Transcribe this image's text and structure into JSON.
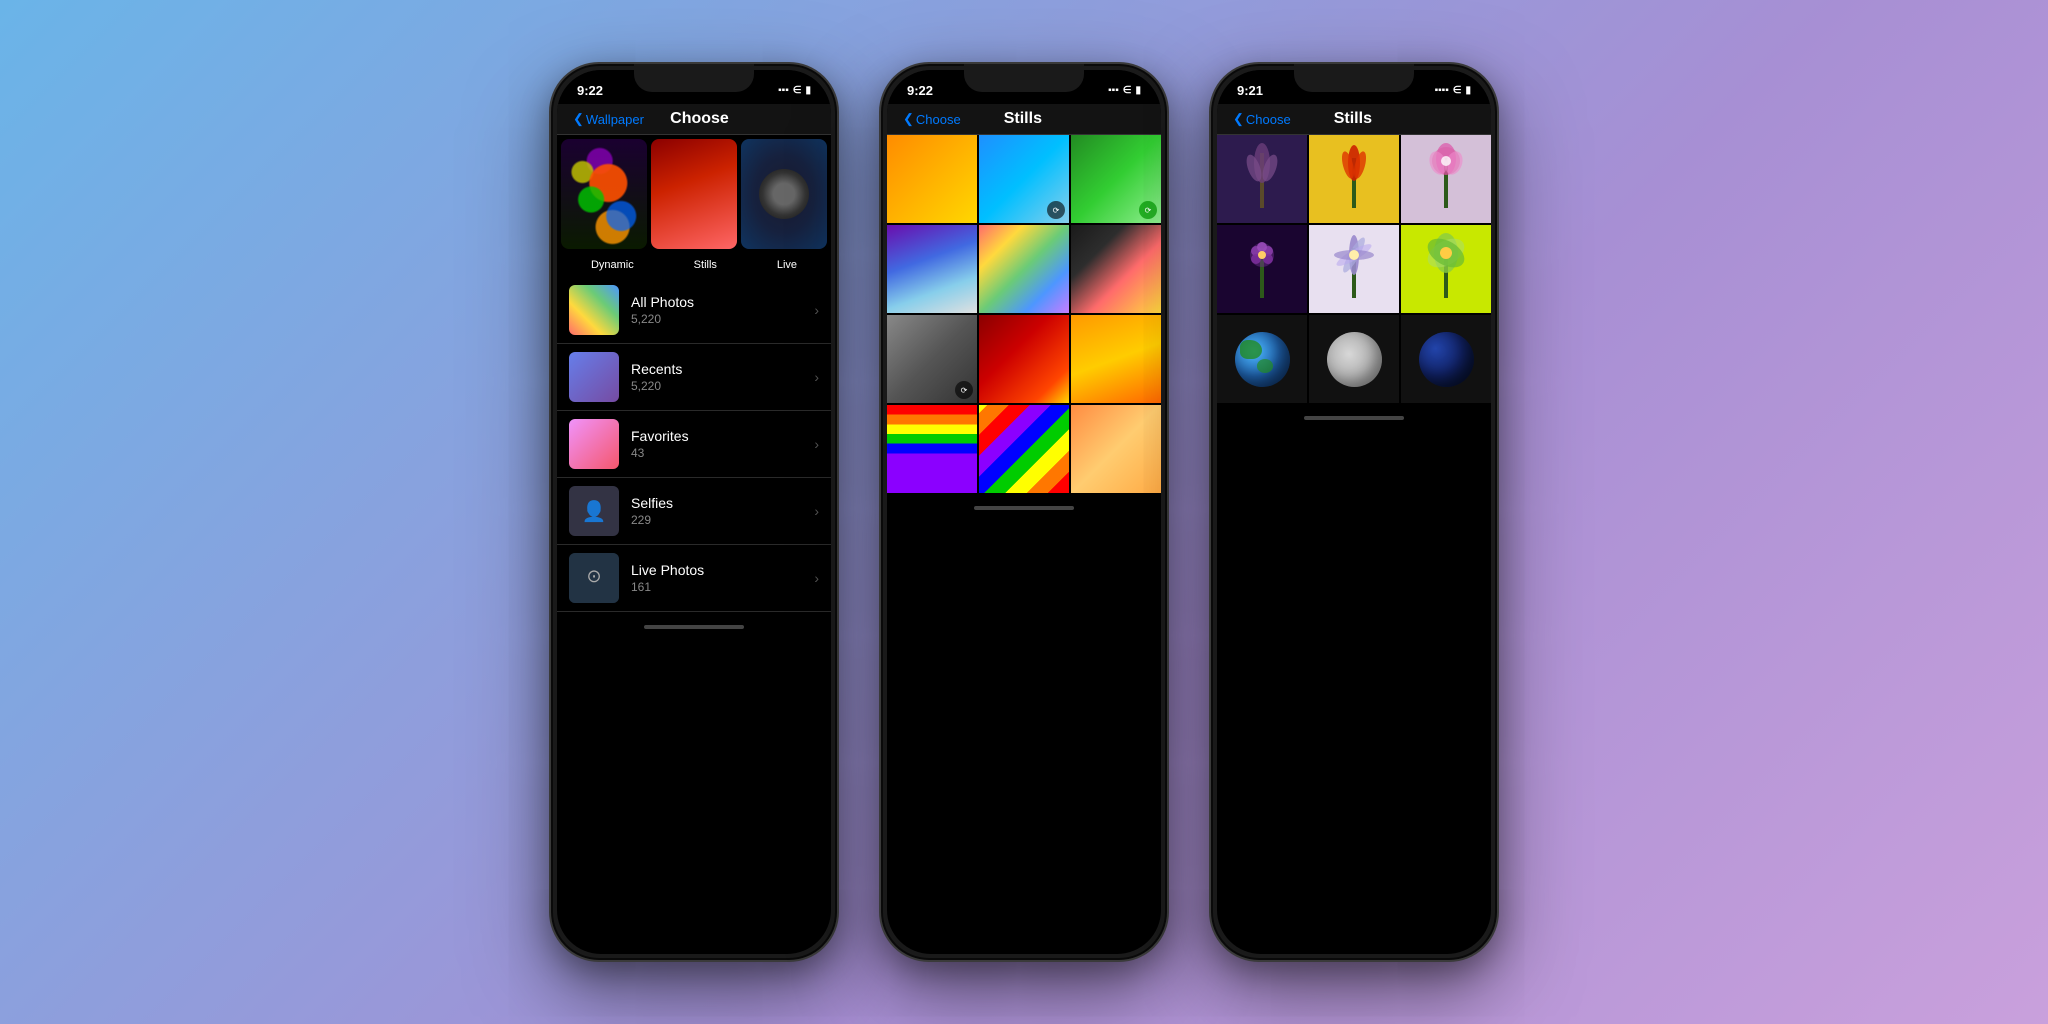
{
  "background": {
    "gradient": "linear-gradient(135deg, #6ab4e8 0%, #a78fd4 60%, #c9a0dc 100%)"
  },
  "phone1": {
    "status": {
      "time": "9:22",
      "signal": "▪▪▪",
      "wifi": "WiFi",
      "battery": "🔋"
    },
    "nav": {
      "back_label": "Wallpaper",
      "title": "Choose"
    },
    "wallpaper_categories": {
      "dynamic_label": "Dynamic",
      "stills_label": "Stills",
      "live_label": "Live"
    },
    "albums": [
      {
        "name": "All Photos",
        "count": "5,220"
      },
      {
        "name": "Recents",
        "count": "5,220"
      },
      {
        "name": "Favorites",
        "count": "43"
      },
      {
        "name": "Selfies",
        "count": "229"
      },
      {
        "name": "Live Photos",
        "count": "161"
      }
    ]
  },
  "phone2": {
    "status": {
      "time": "9:22",
      "signal": "▪▪▪",
      "wifi": "WiFi",
      "battery": "🔋"
    },
    "nav": {
      "back_label": "Choose",
      "title": "Stills"
    }
  },
  "phone3": {
    "status": {
      "time": "9:21",
      "signal": "▪▪▪▪",
      "wifi": "WiFi",
      "battery": "🔋"
    },
    "nav": {
      "back_label": "Choose",
      "title": "Stills"
    }
  }
}
